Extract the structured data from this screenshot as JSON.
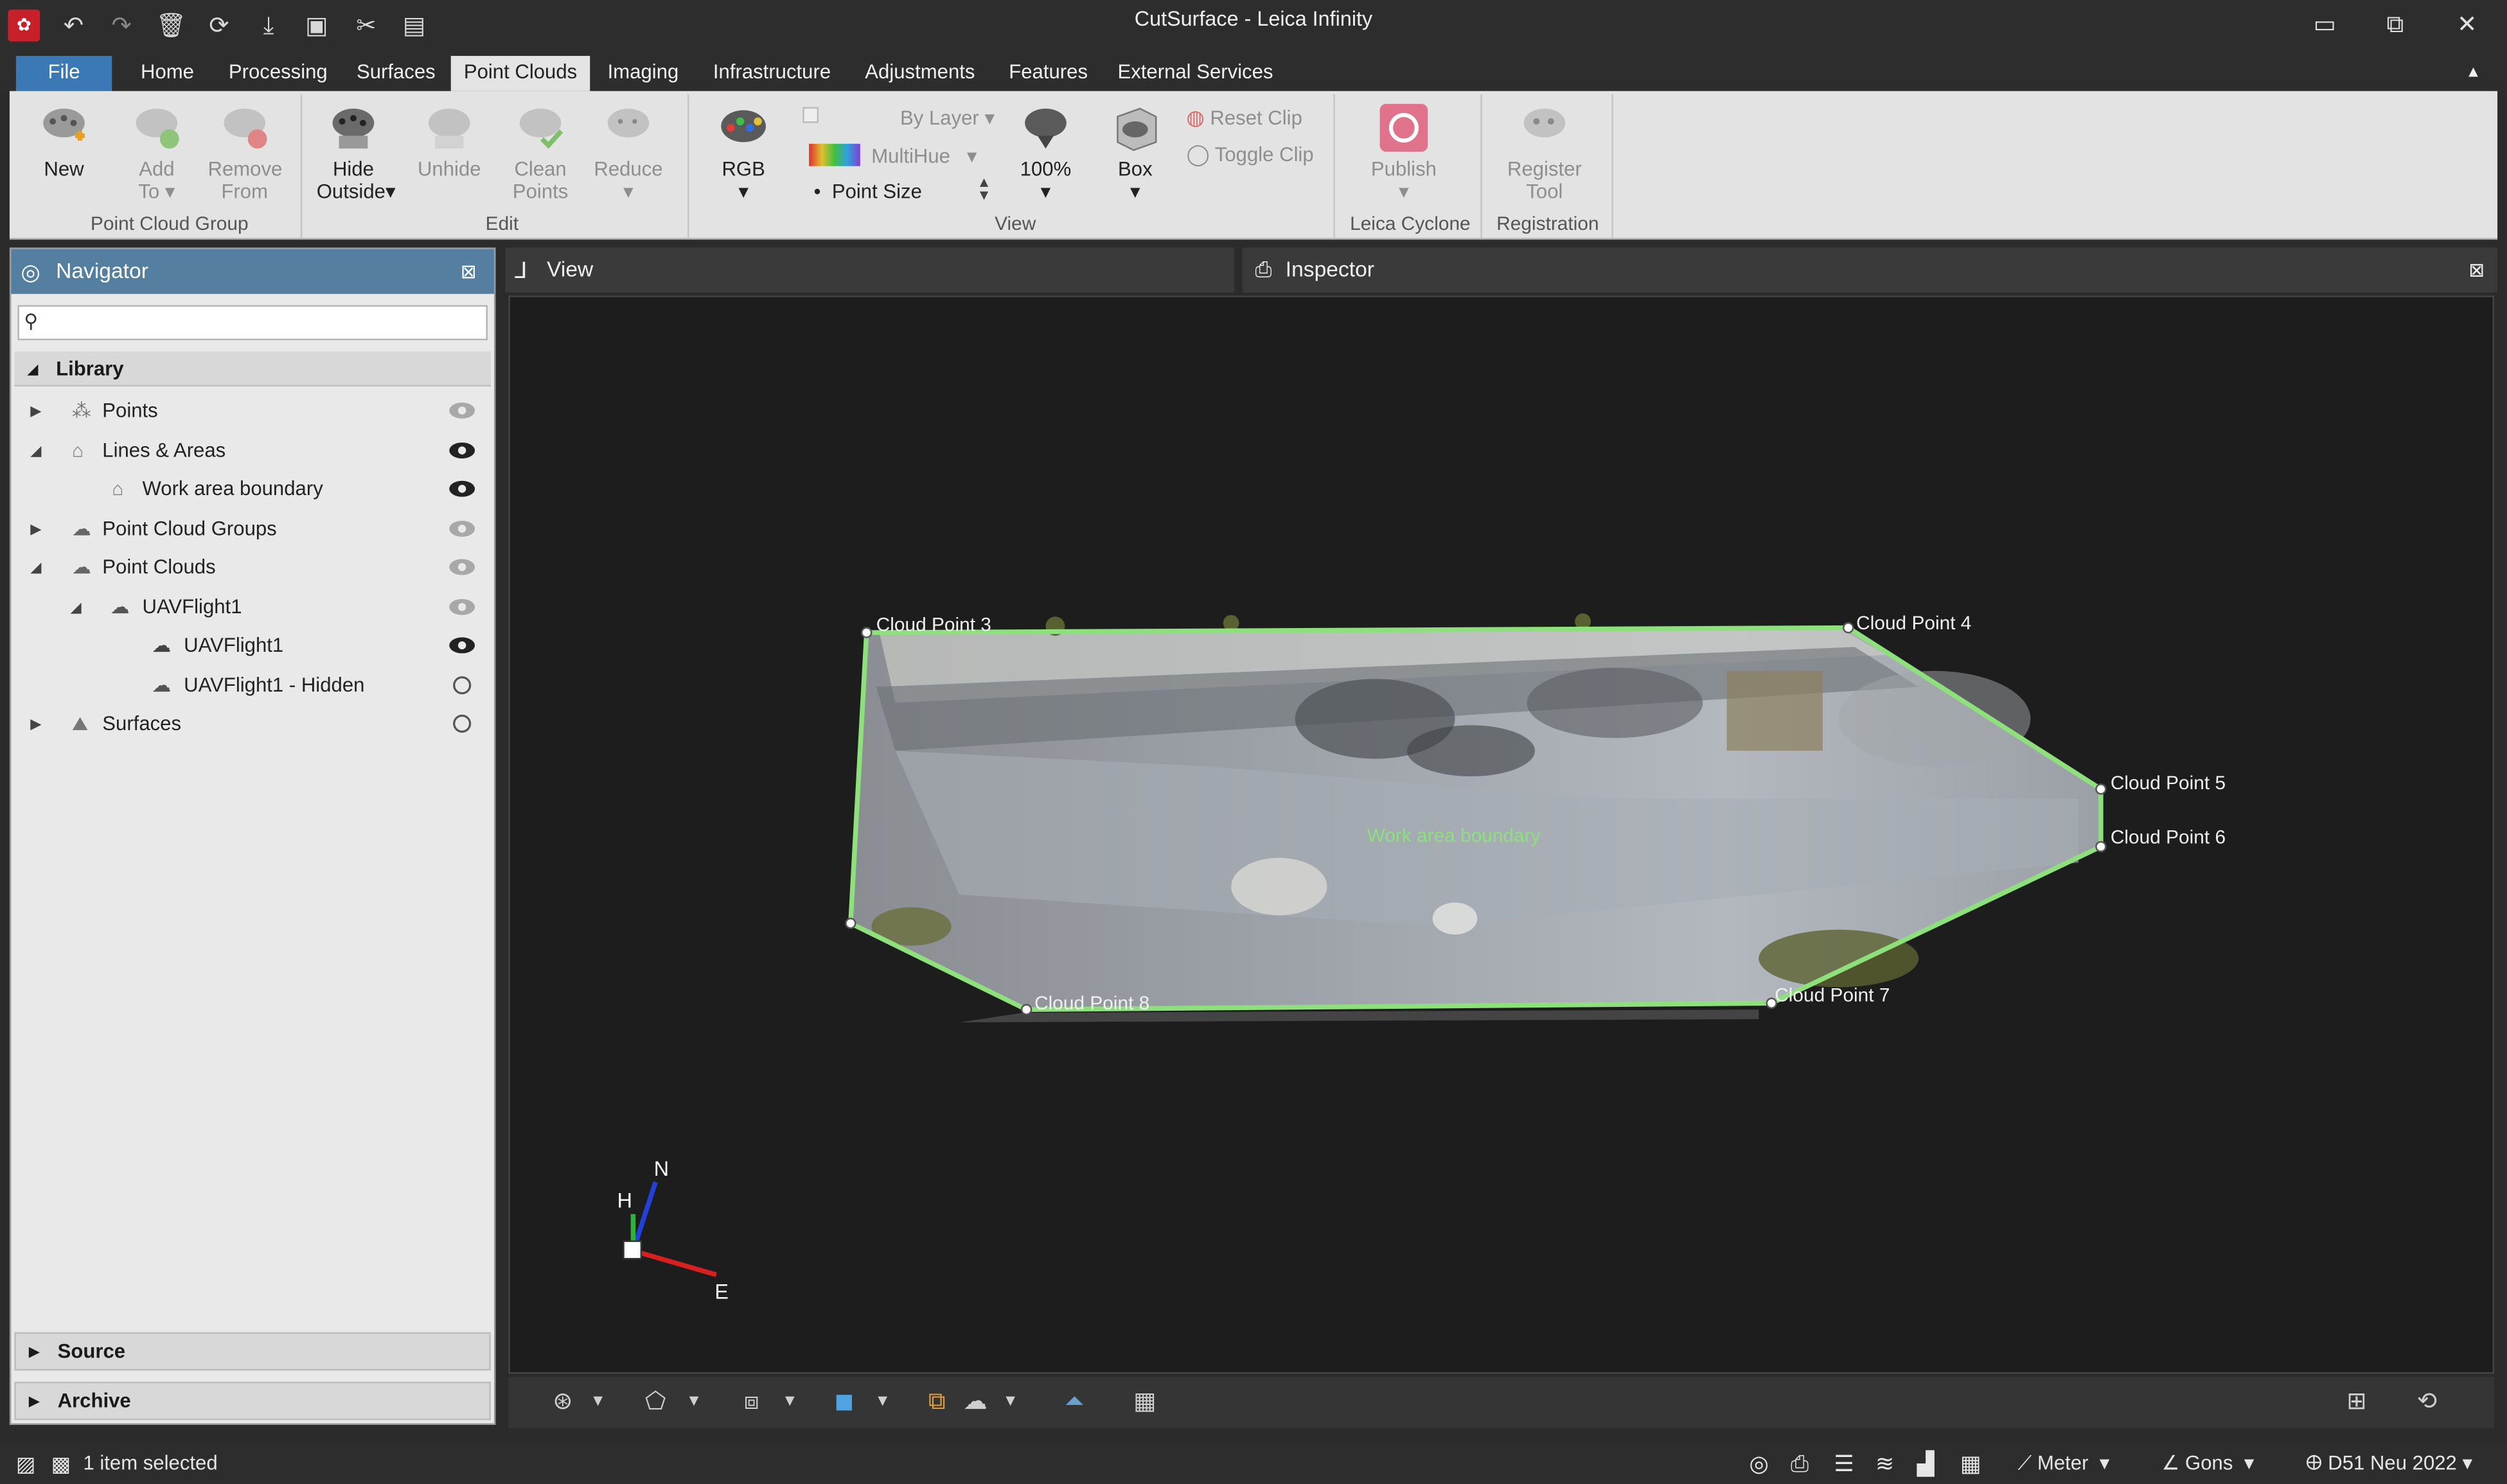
{
  "app": {
    "title": "CutSurface - Leica Infinity"
  },
  "menu": {
    "tabs": [
      "File",
      "Home",
      "Processing",
      "Surfaces",
      "Point Clouds",
      "Imaging",
      "Infrastructure",
      "Adjustments",
      "Features",
      "External Services"
    ],
    "active": "Point Clouds"
  },
  "ribbon": {
    "groups": {
      "point_cloud_group": "Point Cloud Group",
      "edit": "Edit",
      "view": "View",
      "leica_cyclone": "Leica Cyclone",
      "registration": "Registration"
    },
    "new": "New",
    "add_to_1": "Add",
    "add_to_2": "To",
    "remove_from_1": "Remove",
    "remove_from_2": "From",
    "hide_outside_1": "Hide",
    "hide_outside_2": "Outside",
    "unhide": "Unhide",
    "clean_points_1": "Clean",
    "clean_points_2": "Points",
    "reduce": "Reduce",
    "rgb": "RGB",
    "by_layer": "By Layer",
    "multihue": "MultiHue",
    "point_size": "Point Size",
    "percent": "100%",
    "box": "Box",
    "reset_clip": "Reset Clip",
    "toggle_clip": "Toggle Clip",
    "publish": "Publish",
    "register_tool_1": "Register",
    "register_tool_2": "Tool"
  },
  "navigator": {
    "title": "Navigator",
    "search_placeholder": "",
    "library": "Library",
    "items": [
      {
        "label": "Points"
      },
      {
        "label": "Lines & Areas"
      },
      {
        "label": "Work area boundary"
      },
      {
        "label": "Point Cloud Groups"
      },
      {
        "label": "Point Clouds"
      },
      {
        "label": "UAVFlight1"
      },
      {
        "label": "UAVFlight1"
      },
      {
        "label": "UAVFlight1 - Hidden"
      },
      {
        "label": "Surfaces"
      }
    ],
    "source": "Source",
    "archive": "Archive"
  },
  "view": {
    "tab": "View",
    "inspector_tab": "Inspector",
    "labels": {
      "cp3": "Cloud Point 3",
      "cp4": "Cloud Point 4",
      "cp5": "Cloud Point 5",
      "cp6": "Cloud Point 6",
      "cp7": "Cloud Point 7",
      "cp8": "Cloud Point 8",
      "boundary": "Work area boundary"
    },
    "compass": {
      "n": "N",
      "h": "H",
      "e": "E"
    },
    "boundary_color": "#8ee07c"
  },
  "status": {
    "selection": "1 item selected",
    "units": "Meter",
    "angle": "Gons",
    "coord_system": "D51 Neu 2022"
  }
}
